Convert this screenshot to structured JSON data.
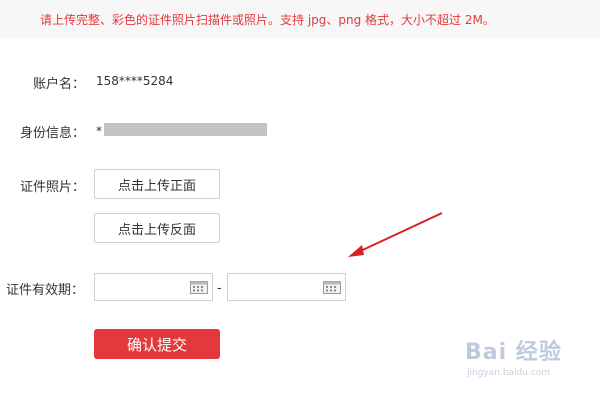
{
  "notice": {
    "text": "请上传完整、彩色的证件照片扫描件或照片。支持 jpg、png 格式，大小不超过 2M。"
  },
  "form": {
    "account": {
      "label": "账户名：",
      "value": "158****5284"
    },
    "identity": {
      "label": "身份信息：",
      "value": "*"
    },
    "photo": {
      "label": "证件照片：",
      "upload_front": "点击上传正面",
      "upload_back": "点击上传反面"
    },
    "validity": {
      "label": "证件有效期：",
      "start_value": "",
      "end_value": "",
      "separator": "-"
    },
    "submit_label": "确认提交"
  },
  "watermark": {
    "brand": "Bai 经验",
    "url": "jingyan.baidu.com"
  },
  "colors": {
    "accent": "#e4393c",
    "notice_bg": "#f7f7f7",
    "annotation_arrow": "#d62020"
  },
  "icons": {
    "calendar": "calendar-icon",
    "arrow": "annotation-arrow"
  }
}
